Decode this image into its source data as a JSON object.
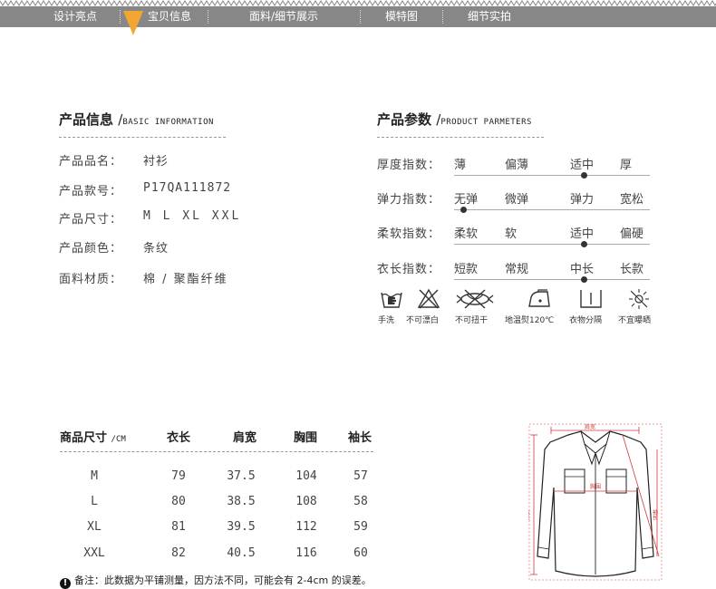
{
  "nav": {
    "items": [
      "设计亮点",
      "宝贝信息",
      "面料/细节展示",
      "模特图",
      "细节实拍"
    ],
    "active_index": 1,
    "bar_color": "#878787",
    "arrow_color": "#f2a531"
  },
  "product_info": {
    "title": "产品信息",
    "title_en": "BASIC INFORMATION",
    "rows": [
      {
        "label": "产品品名：",
        "value": "衬衫"
      },
      {
        "label": "产品款号：",
        "value": "P17QA111872"
      },
      {
        "label": "产品尺寸：",
        "value": "M L XL XXL"
      },
      {
        "label": "产品颜色：",
        "value": "条纹"
      },
      {
        "label": "面料材质：",
        "value": "棉 / 聚酯纤维"
      }
    ]
  },
  "product_params": {
    "title": "产品参数",
    "title_en": "PRODUCT PARMETERS",
    "rows": [
      {
        "label": "厚度指数：",
        "options": [
          "薄",
          "偏薄",
          "适中",
          "厚"
        ],
        "selected": 2
      },
      {
        "label": "弹力指数：",
        "options": [
          "无弹",
          "微弹",
          "弹力",
          "宽松"
        ],
        "selected": 0
      },
      {
        "label": "柔软指数：",
        "options": [
          "柔软",
          "软",
          "适中",
          "偏硬"
        ],
        "selected": 2
      },
      {
        "label": "衣长指数：",
        "options": [
          "短款",
          "常规",
          "中长",
          "长款"
        ],
        "selected": 2
      }
    ]
  },
  "care": [
    {
      "icon": "hand-wash-icon",
      "label": "手洗"
    },
    {
      "icon": "no-bleach-icon",
      "label": "不可漂白"
    },
    {
      "icon": "no-wring-icon",
      "label": "不可扭干"
    },
    {
      "icon": "low-iron-icon",
      "label": "地温熨120℃"
    },
    {
      "icon": "wash-separately-icon",
      "label": "衣物分隔"
    },
    {
      "icon": "no-sun-icon",
      "label": "不宜曝晒"
    }
  ],
  "size_table": {
    "title": "商品尺寸",
    "unit": "/CM",
    "columns": [
      "衣长",
      "肩宽",
      "胸围",
      "袖长"
    ],
    "rows": [
      {
        "size": "M",
        "values": [
          "79",
          "37.5",
          "104",
          "57"
        ]
      },
      {
        "size": "L",
        "values": [
          "80",
          "38.5",
          "108",
          "58"
        ]
      },
      {
        "size": "XL",
        "values": [
          "81",
          "39.5",
          "112",
          "59"
        ]
      },
      {
        "size": "XXL",
        "values": [
          "82",
          "40.5",
          "116",
          "60"
        ]
      }
    ]
  },
  "note": "备注：此数据为平铺测量，因方法不同，可能会有 2-4cm 的误差。",
  "diagram": {
    "shoulder_label": "肩宽",
    "chest_label": "胸围",
    "length_label": "衣长",
    "sleeve_label": "袖长",
    "measure_color": "#d23a3a"
  }
}
